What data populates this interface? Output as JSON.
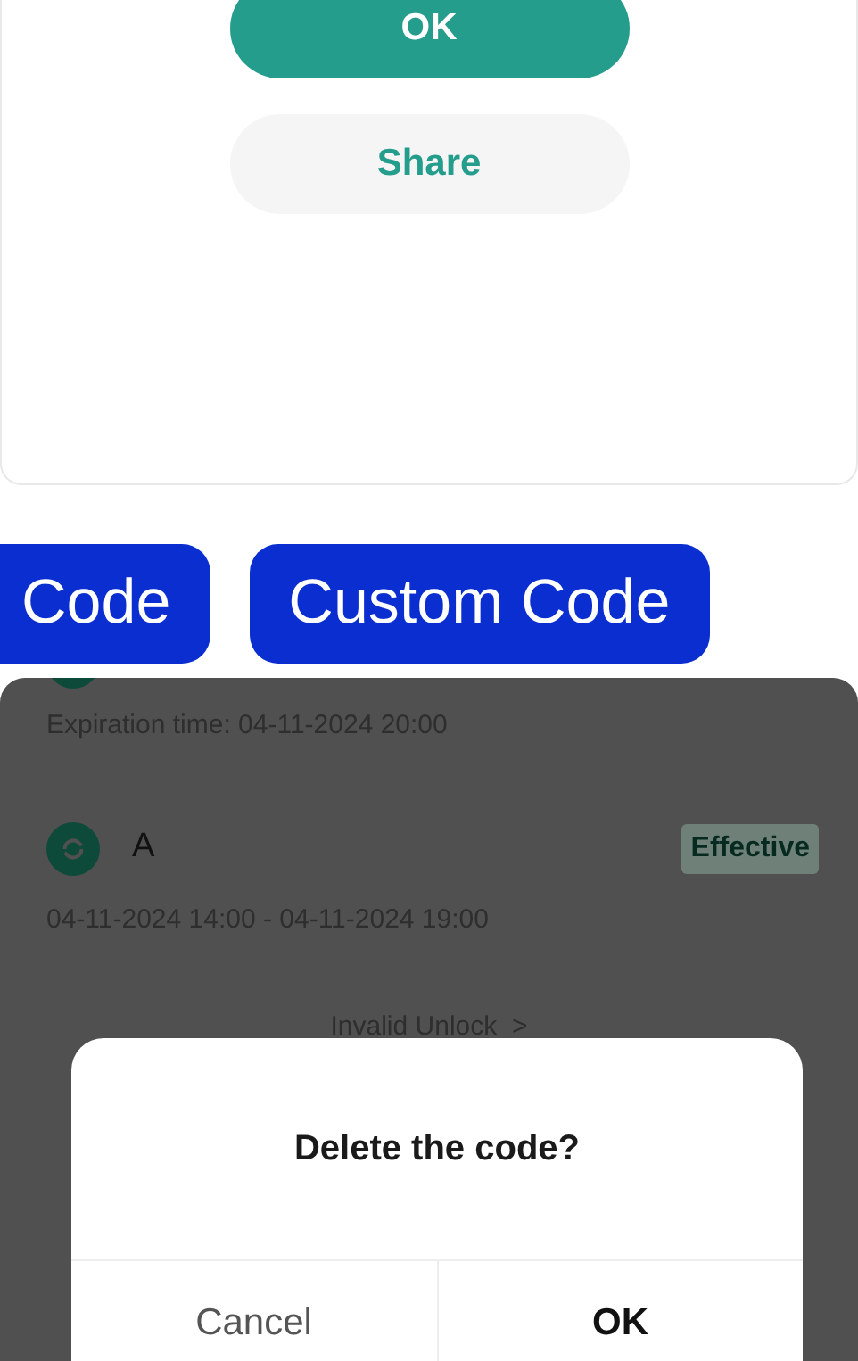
{
  "share_card": {
    "buttons": [
      {
        "kind": "primary",
        "label": "OK"
      },
      {
        "kind": "secondary",
        "label": "Share"
      }
    ]
  },
  "code_buttons": [
    "Code",
    "Custom Code"
  ],
  "code_list": {
    "expiration": "Expiration time: 04-11-2024 20:00",
    "item": {
      "name": "A",
      "status": "Effective",
      "period": "04-11-2024 14:00 - 04-11-2024 19:00"
    },
    "invalid_link": "Invalid Unlock  >"
  },
  "dialog": {
    "title": "Delete the code?",
    "buttons": [
      {
        "kind": "cancel",
        "label": "Cancel"
      },
      {
        "kind": "confirm",
        "label": "OK"
      }
    ]
  }
}
